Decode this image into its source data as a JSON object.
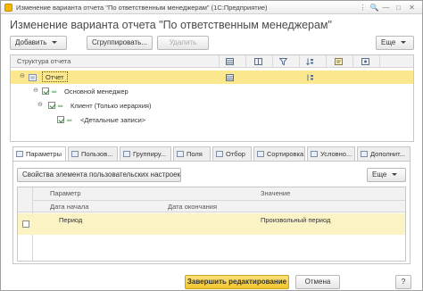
{
  "window": {
    "title": "Изменение варианта отчета \"По ответственным менеджерам\" (1С:Предприятие)",
    "controls": [
      "⋮",
      "🔍",
      "—",
      "□",
      "✕"
    ]
  },
  "page": {
    "heading": "Изменение варианта отчета \"По ответственным менеджерам\""
  },
  "toolbar": {
    "add_label": "Добавить",
    "group_label": "Сгруппировать...",
    "delete_label": "Удалить",
    "more_label": "Еще"
  },
  "structure": {
    "header": "Структура отчета",
    "rows": [
      {
        "label": "Отчет"
      },
      {
        "label": "Основной менеджер"
      },
      {
        "label": "Клиент (Только иерархия)"
      },
      {
        "label": "<Детальные записи>"
      }
    ]
  },
  "tabs": [
    {
      "label": "Параметры"
    },
    {
      "label": "Пользов..."
    },
    {
      "label": "Группиру..."
    },
    {
      "label": "Поля"
    },
    {
      "label": "Отбор"
    },
    {
      "label": "Сортировка"
    },
    {
      "label": "Условно..."
    },
    {
      "label": "Дополнит..."
    }
  ],
  "params": {
    "props_button": "Свойства элемента пользовательских настроек",
    "more_label": "Еще",
    "col_param": "Параметр",
    "col_value": "Значение",
    "col_start": "Дата начала",
    "col_end": "Дата окончания",
    "row_param": "Период",
    "row_value": "Произвольный период"
  },
  "footer": {
    "finish_label": "Завершить редактирование",
    "cancel_label": "Отмена",
    "help_label": "?"
  },
  "colors": {
    "selection": "#fbe88e",
    "row_highlight": "#fcf3c4",
    "primary_button": "#f6d145"
  }
}
